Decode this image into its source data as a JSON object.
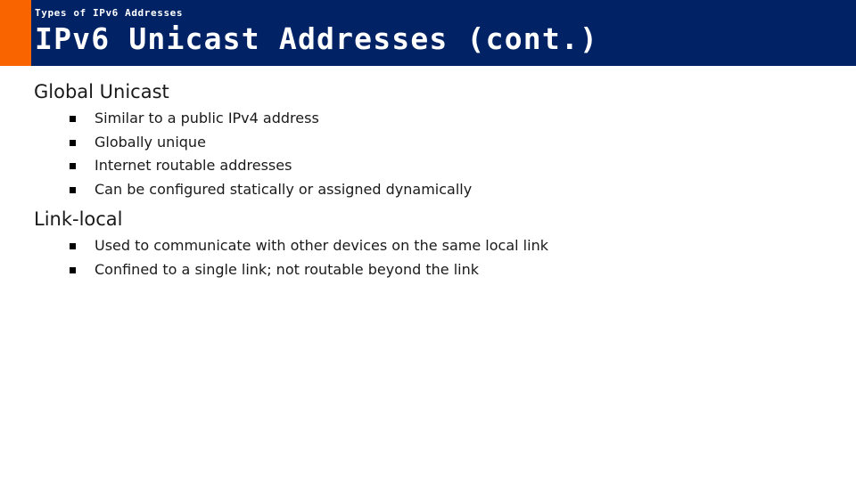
{
  "theme": {
    "header_bg": "#012366",
    "accent_bar": "#fa6400",
    "page_bg": "#ffffff",
    "text_color": "#1a1a1a",
    "bullet_color": "#000000",
    "header_text": "#ffffff"
  },
  "header": {
    "eyebrow": "Types of IPv6 Addresses",
    "title": "IPv6 Unicast Addresses (cont.)"
  },
  "body": {
    "sections": [
      {
        "heading": "Global Unicast",
        "bullet_glyph": "square-bullet",
        "bullets": [
          "Similar to a public IPv4 address",
          "Globally unique",
          "Internet routable addresses",
          "Can be configured statically or assigned dynamically"
        ]
      },
      {
        "heading": "Link-local",
        "bullet_glyph": "square-bullet",
        "bullets": [
          "Used to communicate with other devices on the same local link",
          "Confined to a single link; not routable beyond the link"
        ]
      }
    ]
  }
}
